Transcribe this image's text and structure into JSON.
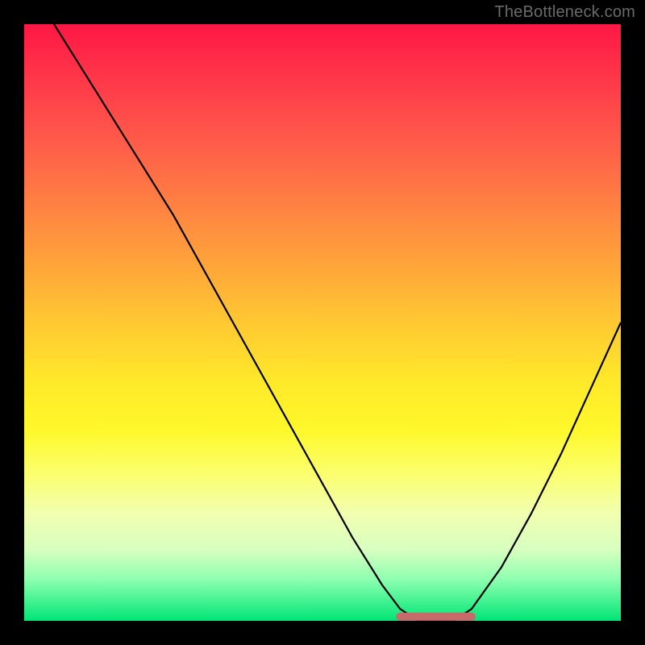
{
  "attribution": "TheBottleneck.com",
  "chart_data": {
    "type": "line",
    "title": "",
    "xlabel": "",
    "ylabel": "",
    "xlim": [
      0,
      100
    ],
    "ylim": [
      0,
      100
    ],
    "series": [
      {
        "name": "curve",
        "x": [
          5,
          10,
          15,
          20,
          25,
          30,
          35,
          40,
          45,
          50,
          55,
          60,
          63,
          66,
          68,
          70,
          72,
          75,
          80,
          85,
          90,
          95,
          100
        ],
        "values": [
          100,
          92,
          84,
          76,
          68,
          59,
          50,
          41,
          32,
          23,
          14,
          6,
          2,
          0,
          0,
          0,
          0,
          2,
          9,
          18,
          28,
          39,
          50
        ]
      },
      {
        "name": "flat-highlight",
        "x": [
          63,
          75
        ],
        "values": [
          0,
          0
        ]
      }
    ],
    "grid": false,
    "legend": false,
    "background_gradient": {
      "top": "#ff1744",
      "mid": "#ffe92a",
      "bottom": "#00e676"
    },
    "highlight_color": "#c76a6a"
  }
}
